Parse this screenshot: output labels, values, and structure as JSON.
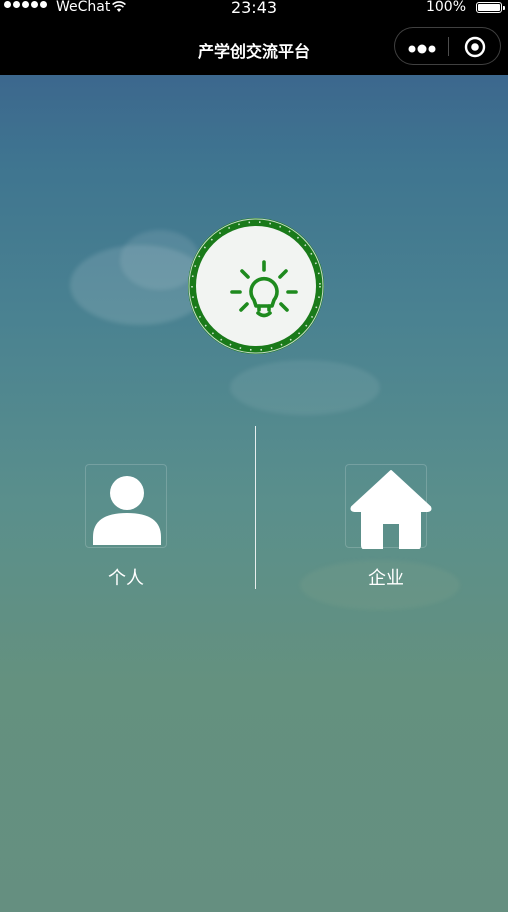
{
  "status_bar": {
    "carrier": "WeChat",
    "time": "23:43",
    "battery": "100%"
  },
  "nav": {
    "title": "产学创交流平台"
  },
  "logo": {
    "icon": "lightbulb-icon",
    "ring_color": "#1a7a1a",
    "icon_color": "#1e8a1e"
  },
  "options": {
    "personal": {
      "label": "个人",
      "icon": "person-icon"
    },
    "company": {
      "label": "企业",
      "icon": "house-icon"
    }
  }
}
